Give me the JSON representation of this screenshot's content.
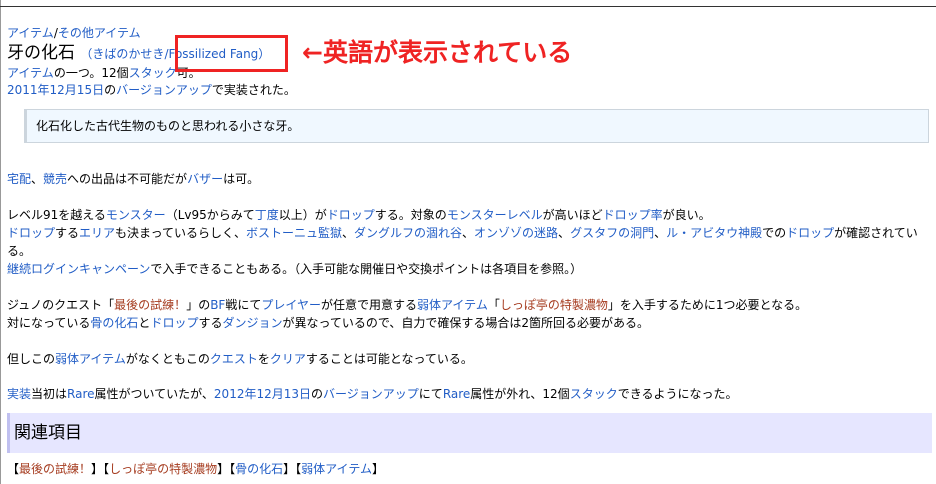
{
  "breadcrumb": {
    "item1": "アイテム",
    "sep": "/",
    "item2": "その他アイテム"
  },
  "title": {
    "main": "牙の化石",
    "reading_open": "（",
    "reading": "きばのかせき",
    "english": "/Fossilized Fang",
    "reading_close": "）"
  },
  "intro": {
    "l1_link": "アイテム",
    "l1_text": "の一つ。12個",
    "l1_link2": "スタック",
    "l1_text2": "可。",
    "l2_link": "2011年12月15日",
    "l2_text": "の",
    "l2_link2": "バージョンアップ",
    "l2_text2": "で実装された。"
  },
  "quote": "化石化した古代生物のものと思われる小さな牙。",
  "p1": {
    "a1": "宅配",
    "t1": "、",
    "a2": "競売",
    "t2": "への出品は不可能だが",
    "a3": "バザー",
    "t3": "は可。"
  },
  "p2": {
    "t1": "レベル91を越える",
    "a1": "モンスター",
    "t2": "（Lv95からみて",
    "a2": "丁度",
    "t3": "以上）が",
    "a3": "ドロップ",
    "t4": "する。対象の",
    "a4": "モンスターレベル",
    "t5": "が高いほど",
    "a5": "ドロップ率",
    "t6": "が良い。",
    "b1": "ドロップ",
    "u1": "する",
    "b2": "エリア",
    "u2": "も決まっているらしく、",
    "b3": "ボストーニュ監獄",
    "u3": "、",
    "b4": "ダングルフの涸れ谷",
    "u4": "、",
    "b5": "オンゾゾの迷路",
    "u5": "、",
    "b6": "グスタフの洞門",
    "u6": "、",
    "b7": "ル・アビタウ神殿",
    "u7": "での",
    "b8": "ドロップ",
    "u8": "が確認されている。",
    "c1": "継続ログインキャンペーン",
    "v1": "で入手できることもある。（入手可能な開催日や交換ポイントは各項目を参照。）"
  },
  "p3": {
    "t1": "ジュノのクエスト「",
    "a1": "最後の試練！",
    "t2": "」の",
    "a2": "BF",
    "t3": "戦にて",
    "a3": "プレイヤー",
    "t4": "が任意で用意する",
    "a4": "弱体アイテム",
    "t5": "「",
    "a5": "しっぽ亭の特製濃物",
    "t6": "」を入手するために1つ必要となる。",
    "u1": "対になっている",
    "b1": "骨の化石",
    "u2": "と",
    "b2": "ドロップ",
    "u3": "する",
    "b3": "ダンジョン",
    "u4": "が異なっているので、自力で確保する場合は2箇所回る必要がある。"
  },
  "p4": {
    "t1": "但しこの",
    "a1": "弱体アイテム",
    "t2": "がなくともこの",
    "a2": "クエスト",
    "t3": "を",
    "a3": "クリア",
    "t4": "することは可能となっている。"
  },
  "p5": {
    "a1": "実装",
    "t1": "当初は",
    "a2": "Rare",
    "t2": "属性がついていたが、",
    "a3": "2012年12月13日",
    "t3": "の",
    "a4": "バージョンアップ",
    "t4": "にて",
    "a5": "Rare",
    "t5": "属性が外れ、12個",
    "a6": "スタック",
    "t6": "できるようになった。"
  },
  "related": {
    "heading": "関連項目",
    "lb": "【",
    "rb": "】",
    "items": [
      "最後の試練！",
      "しっぽ亭の特製濃物",
      "骨の化石",
      "弱体アイテム"
    ]
  },
  "annotation": {
    "text": "←英語が表示されている",
    "color": "#ef2323"
  },
  "colors": {
    "link": "#215dc6",
    "visited": "#a63d21",
    "quote_bg": "#f0f8ff",
    "heading_bg": "#e6e6ff"
  }
}
